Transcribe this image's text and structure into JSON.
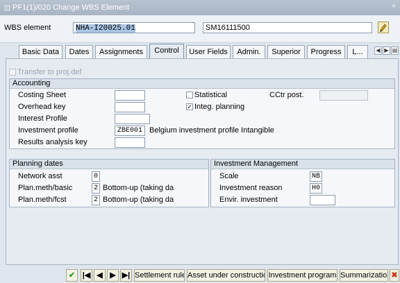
{
  "window": {
    "title": "PF1(1)/020 Change WBS Element",
    "close": "×"
  },
  "header": {
    "wbs_label": "WBS element",
    "wbs_value": "NHA-I20025.01",
    "description": "SM16111500"
  },
  "tabs": [
    {
      "label": "Basic Data"
    },
    {
      "label": "Dates"
    },
    {
      "label": "Assignments"
    },
    {
      "label": "Control"
    },
    {
      "label": "User Fields"
    },
    {
      "label": "Admin."
    },
    {
      "label": "Superior"
    },
    {
      "label": "Progress"
    },
    {
      "label": "L..."
    }
  ],
  "transfer_label": "Transfer to proj.def",
  "accounting": {
    "title": "Accounting",
    "costing_sheet": "Costing Sheet",
    "overhead_key": "Overhead key",
    "interest_profile": "Interest Profile",
    "investment_profile": "Investment profile",
    "investment_profile_value": "ZBE001",
    "investment_profile_desc": "Belgium investment profile Intangible",
    "results_analysis_key": "Results analysis key",
    "statistical": "Statistical",
    "integ_planning": "Integ. planning",
    "integ_planning_checked": "✓",
    "cctr_post": "CCtr post."
  },
  "planning_dates": {
    "title": "Planning dates",
    "network_asst": "Network asst",
    "network_asst_value": "0",
    "plan_meth_basic": "Plan.meth/basic",
    "plan_meth_basic_value": "2",
    "plan_meth_basic_desc": "Bottom-up (taking da",
    "plan_meth_fcst": "Plan.meth/fcst",
    "plan_meth_fcst_value": "2",
    "plan_meth_fcst_desc": "Bottom-up (taking da"
  },
  "investment_mgmt": {
    "title": "Investment Management",
    "scale": "Scale",
    "scale_value": "NB",
    "investment_reason": "Investment reason",
    "investment_reason_value": "H0",
    "envir_investment": "Envir. investment"
  },
  "toolbar": {
    "settlement_rule": "Settlement rule",
    "asset_under_construction": "Asset under construction",
    "investment_program": "Investment program",
    "summarization": "Summarization"
  },
  "icons": {
    "check": "check-icon",
    "first": "first-icon",
    "prev": "previous-icon",
    "next": "next-icon",
    "last": "last-icon",
    "cancel": "cancel-icon",
    "edit": "edit-icon"
  },
  "colors": {
    "title_bar": "#a8b4c4",
    "selection": "#a9c4e3",
    "check_green": "#2f9a1e",
    "cancel_red": "#d23a1a"
  }
}
